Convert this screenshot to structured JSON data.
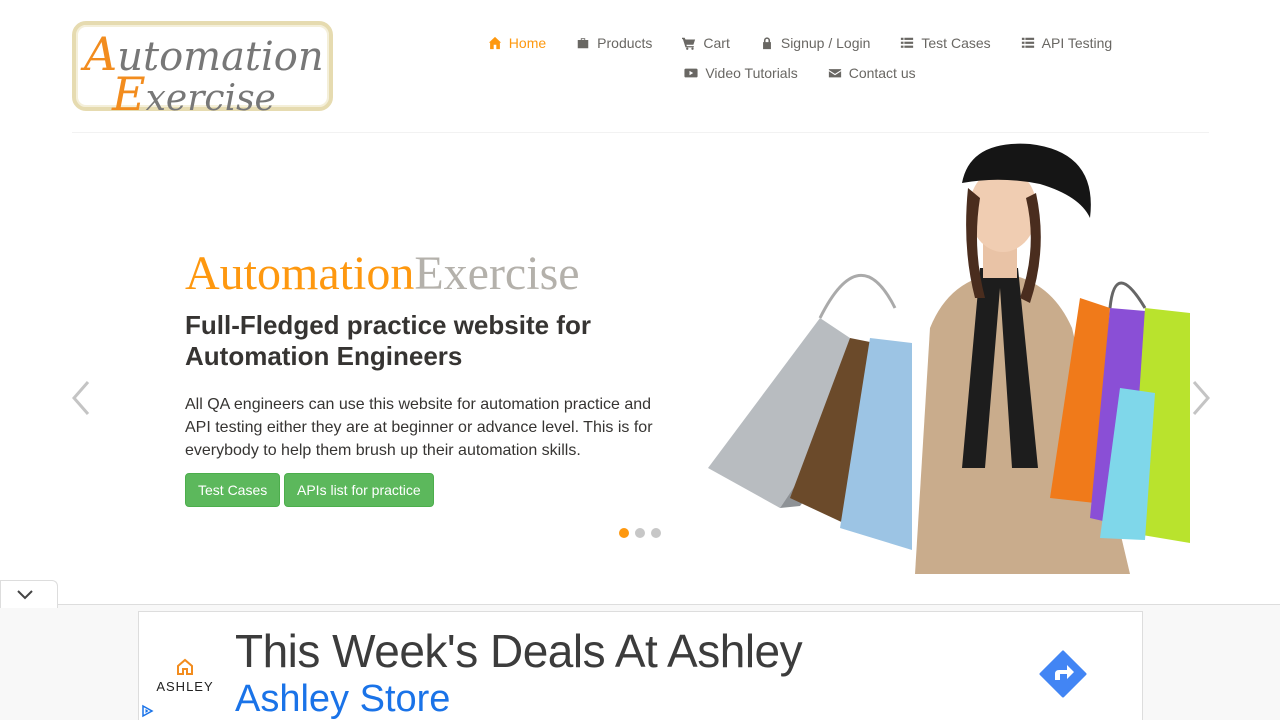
{
  "logo": {
    "line1_cap": "A",
    "line1_rest": "utomation",
    "line2_cap": "E",
    "line2_rest": "xercise"
  },
  "nav": {
    "items": [
      {
        "label": "Home",
        "icon": "home-icon",
        "active": true
      },
      {
        "label": "Products",
        "icon": "briefcase-icon"
      },
      {
        "label": "Cart",
        "icon": "cart-icon"
      },
      {
        "label": "Signup / Login",
        "icon": "lock-icon"
      },
      {
        "label": "Test Cases",
        "icon": "list-icon"
      },
      {
        "label": "API Testing",
        "icon": "list-icon"
      },
      {
        "label": "Video Tutorials",
        "icon": "youtube-icon"
      },
      {
        "label": "Contact us",
        "icon": "envelope-icon"
      }
    ]
  },
  "hero": {
    "title_a": "Automation",
    "title_b": "Exercise",
    "subtitle": "Full-Fledged practice website for Automation Engineers",
    "text": "All QA engineers can use this website for automation practice and API testing either they are at beginner or advance level. This is for everybody to help them brush up their automation skills.",
    "btn_test_cases": "Test Cases",
    "btn_apis": "APIs list for practice",
    "slides": 3,
    "active_slide": 1
  },
  "ad": {
    "brand": "ASHLEY",
    "headline": "This Week's Deals At Ashley",
    "store": "Ashley Store"
  },
  "colors": {
    "accent": "#fe980f",
    "button": "#5cb85c",
    "ad_link": "#1a73e8",
    "ad_go": "#4285f4"
  }
}
